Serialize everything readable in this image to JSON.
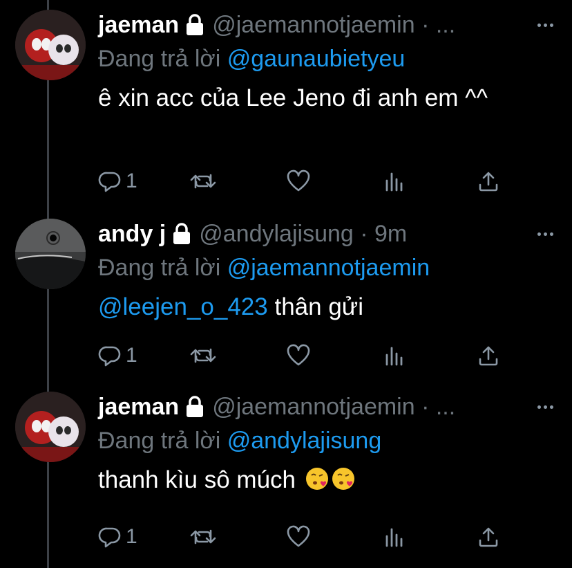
{
  "colors": {
    "background": "#000000",
    "text": "#ffffff",
    "muted": "#6e767d",
    "link": "#1d9bf0",
    "thread_line": "#3d4147",
    "icon": "#8b98a5"
  },
  "tweets": [
    {
      "name": "jaeman",
      "handle": "@jaemannotjaemin · ...",
      "locked": true,
      "reply_prefix": "Đang trả lời ",
      "reply_to": "@gaunaubietyeu",
      "text_mention": "",
      "text": "ê xin acc của Lee Jeno đi anh em ^^",
      "reply_count": "1",
      "avatar_icon": "spider-avatar"
    },
    {
      "name": "andy j",
      "handle": "@andylajisung · 9m",
      "locked": true,
      "reply_prefix": "Đang trả lời ",
      "reply_to": "@jaemannotjaemin",
      "text_mention": "@leejen_o_423",
      "text": " thân gửi",
      "reply_count": "1",
      "avatar_icon": "dark-car-avatar"
    },
    {
      "name": "jaeman",
      "handle": "@jaemannotjaemin · ...",
      "locked": true,
      "reply_prefix": "Đang trả lời ",
      "reply_to": "@andylajisung",
      "text_mention": "",
      "text": "thanh kìu sô múch",
      "emoji": [
        "kissing-face-emoji",
        "kissing-face-emoji"
      ],
      "reply_count": "1",
      "avatar_icon": "spider-avatar"
    }
  ]
}
